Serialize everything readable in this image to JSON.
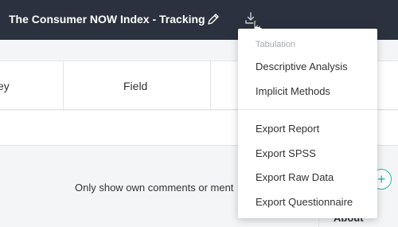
{
  "header": {
    "title": "The Consumer NOW Index - Tracking",
    "edit_icon": "pencil-icon",
    "download_icon": "download-icon",
    "cursor_icon": "hand-pointer-icon"
  },
  "table": {
    "columns": [
      "ey",
      "Field"
    ]
  },
  "comments": {
    "filter_text": "Only show own comments or ment",
    "add_icon": "plus-icon",
    "about_label": "About"
  },
  "menu": {
    "section_label": "Tabulation",
    "tabulation_items": [
      "Descriptive Analysis",
      "Implicit Methods"
    ],
    "export_items": [
      "Export Report",
      "Export SPSS",
      "Export Raw Data",
      "Export Questionnaire"
    ]
  },
  "colors": {
    "header_bg": "#2b313e",
    "accent": "#2bb5a8"
  }
}
